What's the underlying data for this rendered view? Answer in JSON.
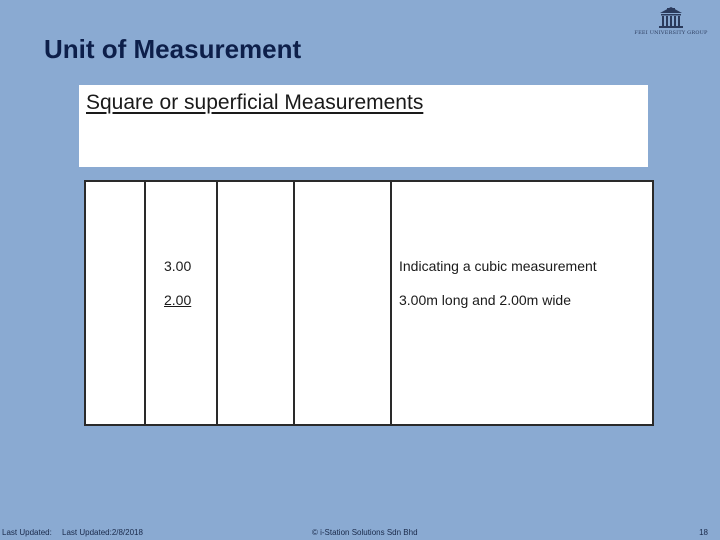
{
  "slide": {
    "title": "Unit of Measurement",
    "logo_text": "FEEI UNIVERSITY GROUP",
    "subtitle": "Square or superficial Measurements"
  },
  "table": {
    "rows": [
      {
        "value": "3.00",
        "description": "Indicating a cubic measurement"
      },
      {
        "value": "2.00",
        "description": "3.00m long and  2.00m wide"
      }
    ]
  },
  "footer": {
    "updated_label": "Last Updated:",
    "updated_value": "Last Updated:2/8/2018",
    "copyright": "© i-Station Solutions Sdn Bhd",
    "page_number": "18"
  },
  "colors": {
    "background": "#8aaad2",
    "title": "#0d1f4a",
    "panel": "#ffffff"
  }
}
